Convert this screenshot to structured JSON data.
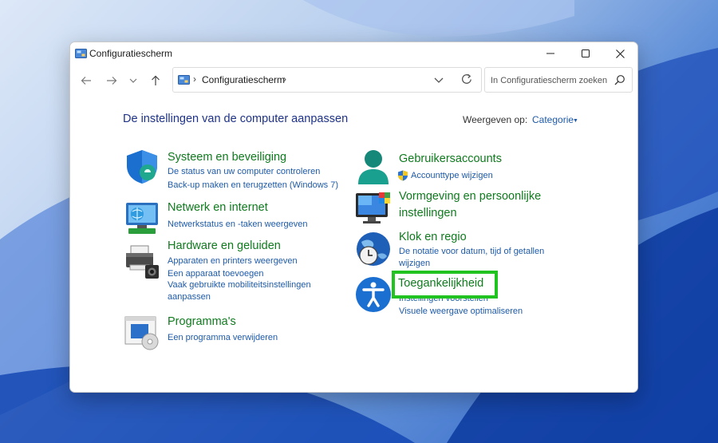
{
  "window": {
    "title": "Configuratiescherm"
  },
  "address": {
    "path_item": "Configuratiescherm",
    "separator": "›"
  },
  "search": {
    "placeholder": "In Configuratiescherm zoeken"
  },
  "heading": "De instellingen van de computer aanpassen",
  "view_by": {
    "label": "Weergeven op:",
    "value": "Categorie"
  },
  "left_categories": [
    {
      "title": "Systeem en beveiliging",
      "icon": "shield-icon",
      "links": [
        "De status van uw computer controleren",
        "Back-up maken en terugzetten (Windows 7)"
      ]
    },
    {
      "title": "Netwerk en internet",
      "icon": "network-icon",
      "links": [
        "Netwerkstatus en -taken weergeven"
      ]
    },
    {
      "title": "Hardware en geluiden",
      "icon": "printer-icon",
      "links": [
        "Apparaten en printers weergeven",
        "Een apparaat toevoegen",
        "Vaak gebruikte mobiliteitsinstellingen aanpassen"
      ]
    },
    {
      "title": "Programma's",
      "icon": "programs-icon",
      "links": [
        "Een programma verwijderen"
      ]
    }
  ],
  "right_categories": [
    {
      "title": "Gebruikersaccounts",
      "icon": "user-icon",
      "links": [
        "Accounttype wijzigen"
      ]
    },
    {
      "title": "Vormgeving en persoonlijke instellingen",
      "icon": "appearance-icon",
      "links": []
    },
    {
      "title": "Klok en regio",
      "icon": "clock-globe-icon",
      "links": [
        "De notatie voor datum, tijd of getallen wijzigen"
      ]
    },
    {
      "title": "Toegankelijkheid",
      "icon": "accessibility-icon",
      "links": [
        "Instellingen voorstellen",
        "Visuele weergave optimaliseren"
      ]
    }
  ],
  "colors": {
    "heading": "#1e3287",
    "category_title": "#0f7a1e",
    "link": "#1e5aa8",
    "highlight": "#21c321"
  }
}
